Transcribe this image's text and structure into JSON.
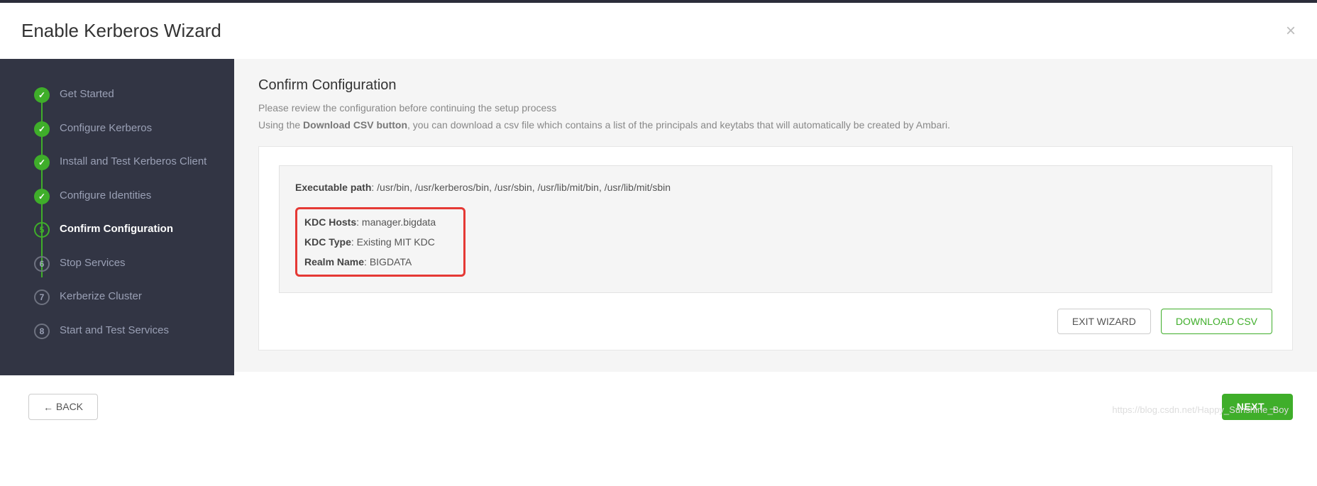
{
  "header": {
    "title": "Enable Kerberos Wizard"
  },
  "sidebar": {
    "steps": [
      {
        "label": "Get Started",
        "state": "done"
      },
      {
        "label": "Configure Kerberos",
        "state": "done"
      },
      {
        "label": "Install and Test Kerberos Client",
        "state": "done"
      },
      {
        "label": "Configure Identities",
        "state": "done"
      },
      {
        "label": "Confirm Configuration",
        "state": "current",
        "number": "5"
      },
      {
        "label": "Stop Services",
        "state": "pending",
        "number": "6"
      },
      {
        "label": "Kerberize Cluster",
        "state": "pending",
        "number": "7"
      },
      {
        "label": "Start and Test Services",
        "state": "pending",
        "number": "8"
      }
    ]
  },
  "content": {
    "title": "Confirm Configuration",
    "desc1": "Please review the configuration before continuing the setup process",
    "desc2_pre": "Using the ",
    "desc2_bold": "Download CSV button",
    "desc2_post": ", you can download a csv file which contains a list of the principals and keytabs that will automatically be created by Ambari.",
    "config": {
      "exec_path_label": "Executable path",
      "exec_path_value": ": /usr/bin, /usr/kerberos/bin, /usr/sbin, /usr/lib/mit/bin, /usr/lib/mit/sbin",
      "kdc_hosts_label": "KDC Hosts",
      "kdc_hosts_value": ": manager.bigdata",
      "kdc_type_label": "KDC Type",
      "kdc_type_value": ": Existing MIT KDC",
      "realm_label": "Realm Name",
      "realm_value": ": BIGDATA"
    },
    "buttons": {
      "exit": "EXIT WIZARD",
      "download": "DOWNLOAD CSV"
    }
  },
  "footer": {
    "back": "BACK",
    "next": "NEXT"
  },
  "watermark": "https://blog.csdn.net/Happy_Sunshine_Boy"
}
